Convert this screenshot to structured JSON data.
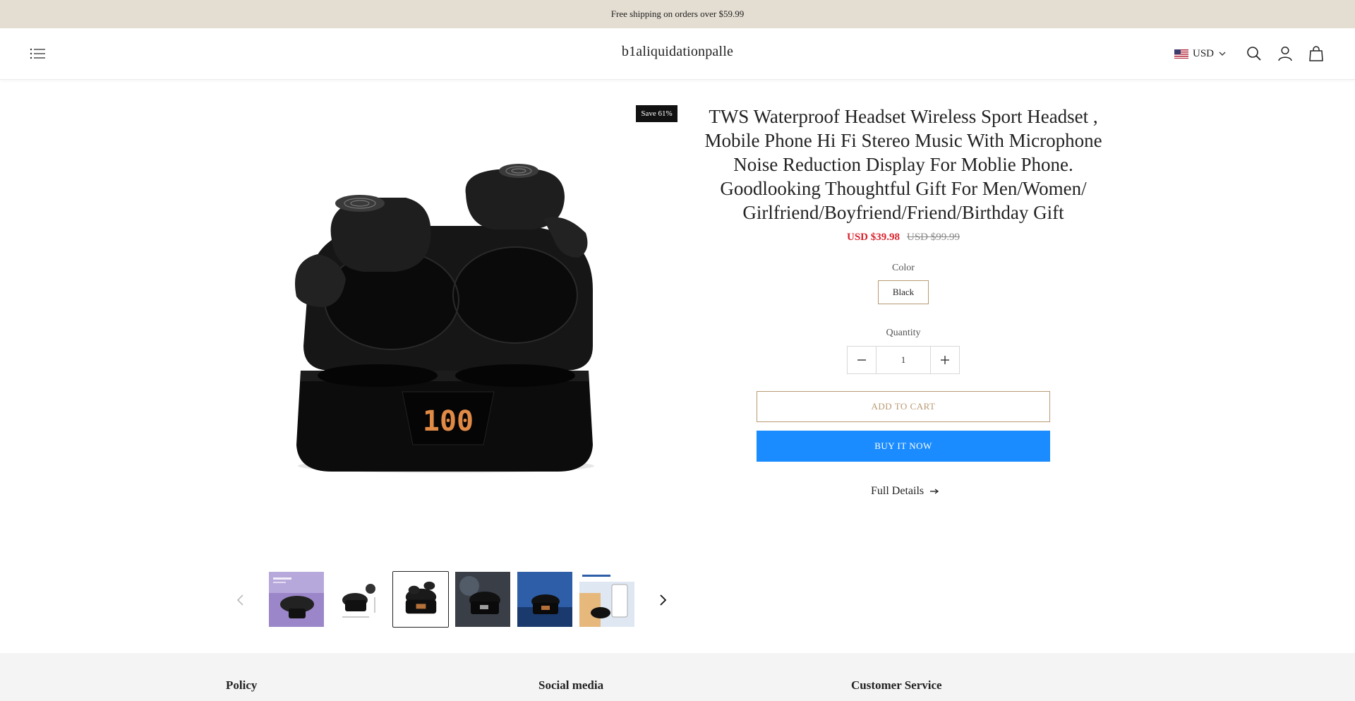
{
  "announcement": {
    "text": "Free shipping on orders over $59.99"
  },
  "header": {
    "brand": "b1aliquidationpalle",
    "currency": "USD",
    "icons": [
      "menu-icon",
      "us-flag-icon",
      "chevron-down-icon",
      "search-icon",
      "account-icon",
      "cart-bag-icon"
    ]
  },
  "product": {
    "save_badge": "Save 61%",
    "title": "TWS Waterproof Headset Wireless Sport Headset , Mobile Phone Hi Fi Stereo Music With Microphone Noise Reduction Display For Moblie Phone. Goodlooking Thoughtful Gift For Men/Women/ Girlfriend/Boyfriend/Friend/Birthday Gift",
    "price": "USD $39.98",
    "compare_price": "USD $99.99",
    "color_label": "Color",
    "color_selected": "Black",
    "quantity_label": "Quantity",
    "quantity_value": "1",
    "add_to_cart": "ADD TO CART",
    "buy_now": "BUY IT NOW",
    "full_details": "Full Details",
    "accent_color": "#b89a74",
    "buy_color": "#1a8cff",
    "sale_color": "#d9232d",
    "led_display": "100"
  },
  "gallery": {
    "thumbnails": [
      {
        "name": "thumb-purple-case",
        "active": false
      },
      {
        "name": "thumb-dimensions",
        "active": false
      },
      {
        "name": "thumb-black-case",
        "active": true
      },
      {
        "name": "thumb-dark-scene",
        "active": false
      },
      {
        "name": "thumb-blue-scene",
        "active": false
      },
      {
        "name": "thumb-smart-connection",
        "active": false
      }
    ]
  },
  "footer": {
    "headings": [
      "Policy",
      "Social media",
      "Customer Service"
    ]
  }
}
